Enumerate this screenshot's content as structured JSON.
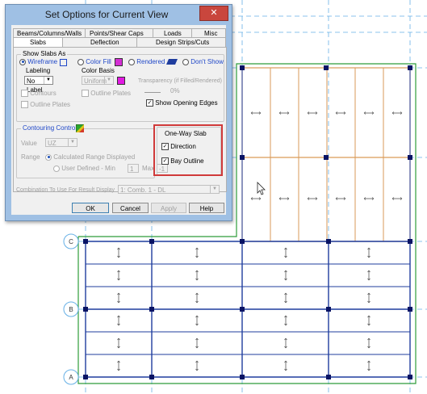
{
  "dialog": {
    "title": "Set Options for Current View",
    "close_icon": "close-icon",
    "tabs_row1": [
      "Beams/Columns/Walls",
      "Points/Shear Caps",
      "Loads",
      "Misc"
    ],
    "tabs_row2": [
      "Slabs",
      "Deflection",
      "Design Strips/Cuts"
    ],
    "active_tab": "Slabs",
    "show_slabs_as": {
      "label": "Show Slabs As",
      "options": [
        "Wireframe",
        "Color Fill",
        "Rendered",
        "Don't Show"
      ],
      "selected": "Wireframe",
      "wireframe_icon": "wireframe-square-icon",
      "color_fill_color": "#d42fd4",
      "rendered_icon": "rendered-slab-icon"
    },
    "labeling": {
      "label": "Labeling",
      "value": "No Label"
    },
    "color_basis": {
      "label": "Color Basis",
      "value": "Uniform",
      "color": "#e21ae2"
    },
    "transparency": {
      "label": "Transparency (if Filled/Rendered)",
      "value": "0%"
    },
    "contours": {
      "label": "Contours",
      "checked": false
    },
    "outline_plates": {
      "label": "Outline Plates",
      "checked": false
    },
    "outline_plates2": {
      "label": "Outline Plates",
      "checked": false
    },
    "show_opening_edges": {
      "label": "Show Opening Edges",
      "checked": true
    },
    "contouring_control": {
      "label": "Contouring Control",
      "icon": "contour-icon",
      "value_label": "Value",
      "value": "UZ",
      "range_label": "Range",
      "range_options": [
        "Calculated Range Displayed",
        "User Defined - Min"
      ],
      "range_selected": "Calculated Range Displayed",
      "min_value": "1",
      "max_label": "Max",
      "max_value": "-1"
    },
    "one_way_slab": {
      "label": "One-Way Slab",
      "direction": {
        "label": "Direction",
        "checked": true
      },
      "bay_outline": {
        "label": "Bay Outline",
        "checked": true
      }
    },
    "combination": {
      "label": "Combination To Use For Result Display",
      "value": "1: Comb. 1 - DL"
    },
    "buttons": [
      "OK",
      "Cancel",
      "Apply",
      "Help"
    ]
  },
  "drawing": {
    "grid_labels": [
      "C",
      "B",
      "A"
    ],
    "colors": {
      "gridline": "#66b0e6",
      "beam": "#1f3d9e",
      "slab_edge": "#2e9c3a",
      "bay_outline": "#d99a58",
      "support": "#0a1464",
      "arrow": "#555555"
    },
    "cursor_icon": "mouse-pointer-icon"
  }
}
